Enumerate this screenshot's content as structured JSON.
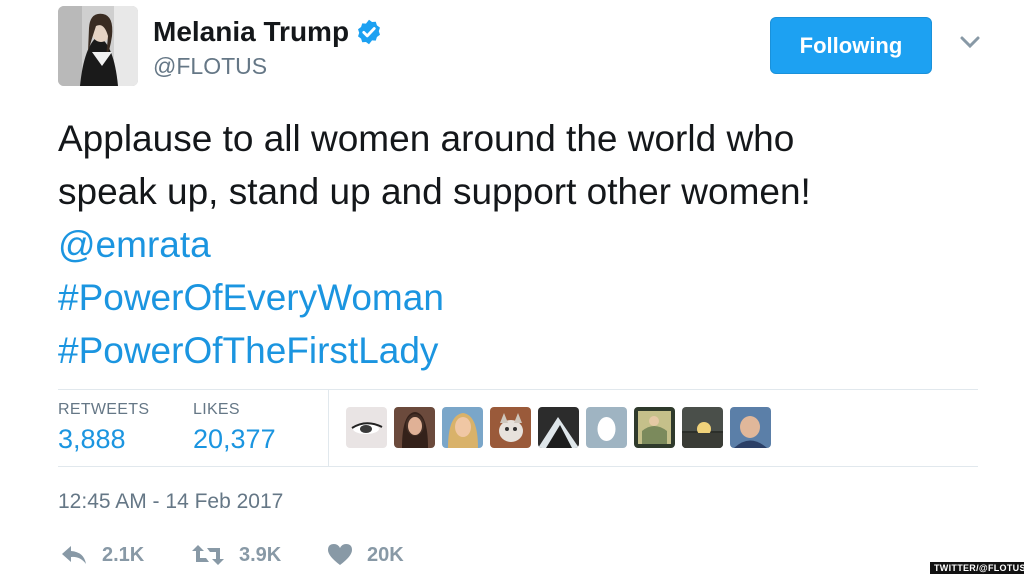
{
  "tweet": {
    "author": {
      "name": "Melania Trump",
      "handle": "@FLOTUS",
      "verified": true
    },
    "follow_button": "Following",
    "text_lines": [
      "Applause to all women around the world who",
      "speak up, stand up and support other women!"
    ],
    "mention": "@emrata",
    "hashtags": [
      "#PowerOfEveryWoman",
      "#PowerOfTheFirstLady"
    ],
    "stats": {
      "retweets_label": "RETWEETS",
      "retweets_value": "3,888",
      "likes_label": "LIKES",
      "likes_value": "20,377"
    },
    "timestamp": "12:45 AM - 14 Feb 2017",
    "actions": {
      "reply": "2.1K",
      "retweet": "3.9K",
      "like": "20K"
    },
    "liker_avatar_count": 9
  },
  "credit": "TWITTER/@FLOTUS",
  "colors": {
    "accent": "#1da1f2",
    "link": "#1b95e0",
    "muted": "#657786"
  }
}
